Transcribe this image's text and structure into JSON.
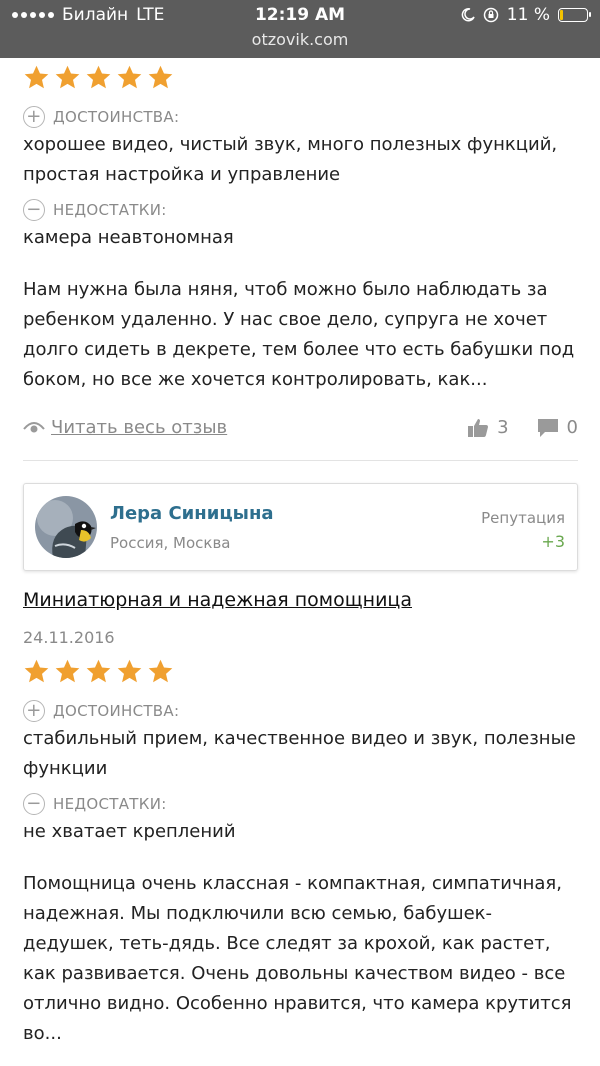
{
  "status_bar": {
    "carrier": "Билайн",
    "network": "LTE",
    "time": "12:19 AM",
    "domain": "otzovik.com",
    "battery": "11 %",
    "battery_color": "#f5c400"
  },
  "review1": {
    "stars": 5,
    "pros_label": "ДОСТОИНСТВА:",
    "pros_text": "хорошее видео, чистый звук, много полезных функций, простая настройка и управление",
    "cons_label": "НЕДОСТАТКИ:",
    "cons_text": "камера неавтономная",
    "body": "Нам нужна была няня, чтоб можно было наблюдать за ребенком удаленно. У нас свое дело, супруга не хочет долго сидеть в декрете, тем более что есть бабушки под боком, но все же хочется контролировать, как...",
    "read_more": "Читать весь отзыв",
    "likes": "3",
    "comments": "0"
  },
  "review2": {
    "author": {
      "name": "Лера Синицына",
      "location": "Россия, Москва",
      "reputation_label": "Репутация",
      "reputation_value": "+3"
    },
    "title": "Миниатюрная и надежная помощница",
    "date": "24.11.2016",
    "stars": 5,
    "pros_label": "ДОСТОИНСТВА:",
    "pros_text": "стабильный прием, качественное видео и звук, полезные функции",
    "cons_label": "НЕДОСТАТКИ:",
    "cons_text": "не хватает креплений",
    "body": "Помощница очень классная - компактная, симпатичная, надежная. Мы подключили всю семью, бабушек-дедушек, теть-дядь. Все следят за крохой, как растет, как развивается. Очень довольны качеством видео - все отлично видно. Особенно нравится, что камера крутится во..."
  },
  "colors": {
    "star": "#f0a030",
    "author_link": "#2e6f8e",
    "reputation": "#6aa84f"
  }
}
